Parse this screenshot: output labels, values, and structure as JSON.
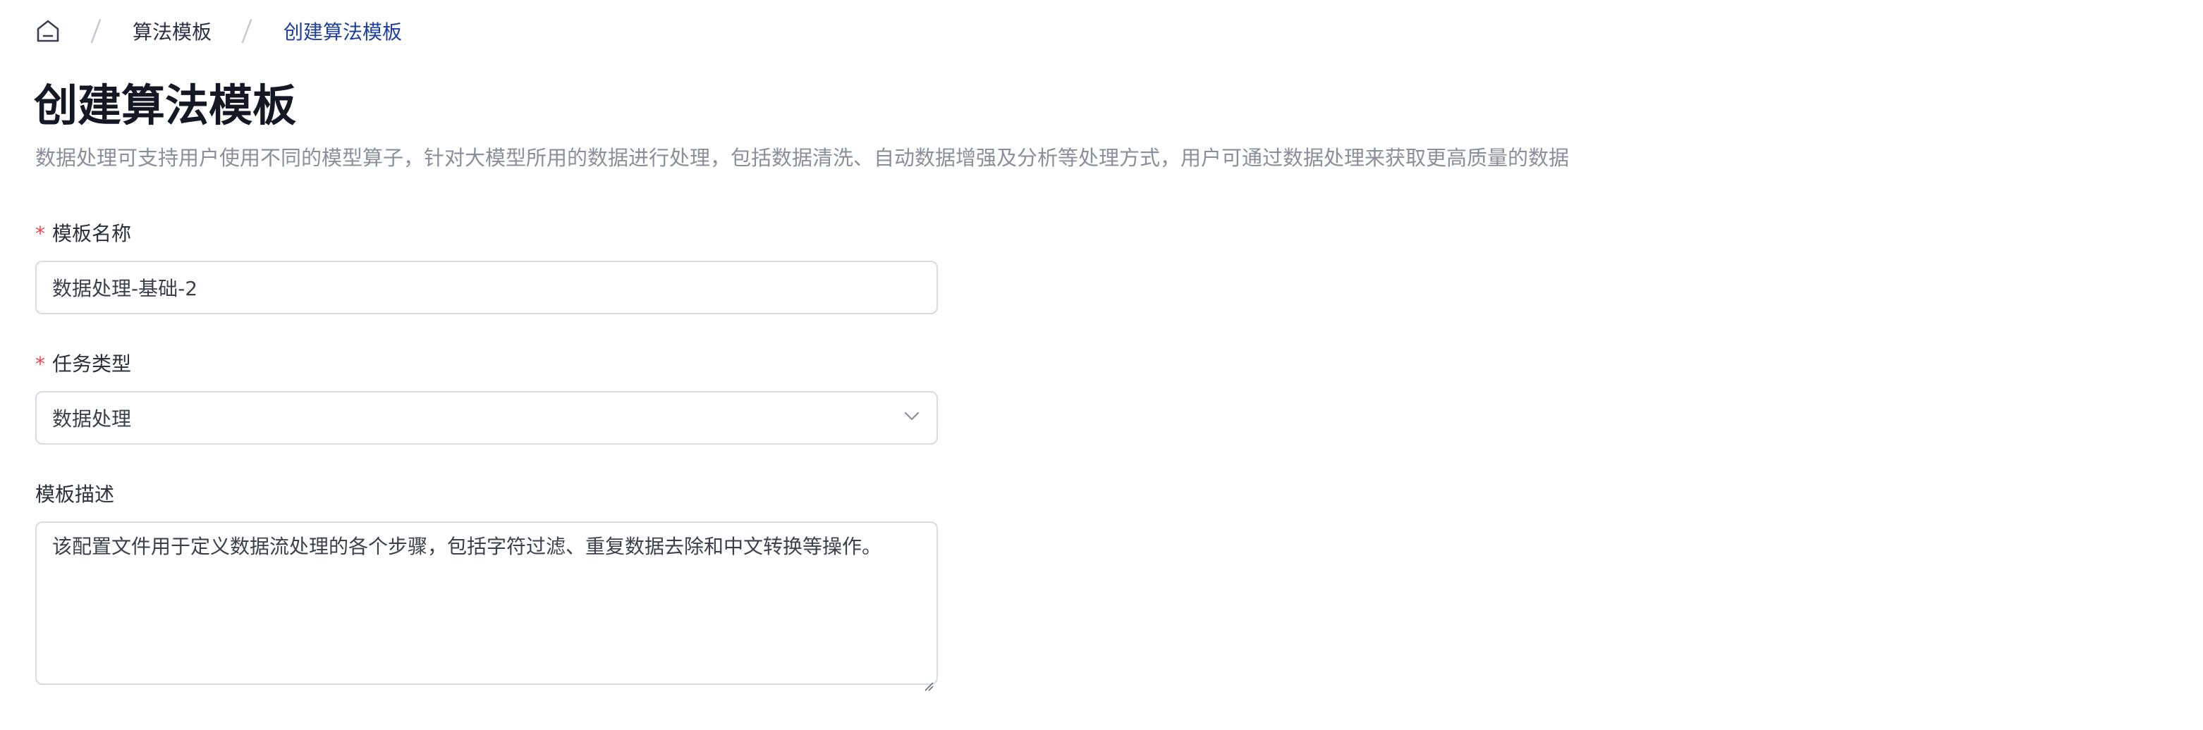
{
  "breadcrumb": {
    "home_icon": "home-icon",
    "items": [
      "算法模板",
      "创建算法模板"
    ]
  },
  "page": {
    "title": "创建算法模板",
    "description": "数据处理可支持用户使用不同的模型算子，针对大模型所用的数据进行处理，包括数据清洗、自动数据增强及分析等处理方式，用户可通过数据处理来获取更高质量的数据"
  },
  "form": {
    "required_mark": "*",
    "template_name": {
      "label": "模板名称",
      "value": "数据处理-基础-2"
    },
    "task_type": {
      "label": "任务类型",
      "value": "数据处理",
      "icon": "chevron-down-icon"
    },
    "template_desc": {
      "label": "模板描述",
      "value": "该配置文件用于定义数据流处理的各个步骤，包括字符过滤、重复数据去除和中文转换等操作。"
    }
  },
  "colors": {
    "required": "#e5484d",
    "breadcrumb_current": "#1e3fa0",
    "description": "#8a8f99",
    "border": "#d8dbe2"
  }
}
